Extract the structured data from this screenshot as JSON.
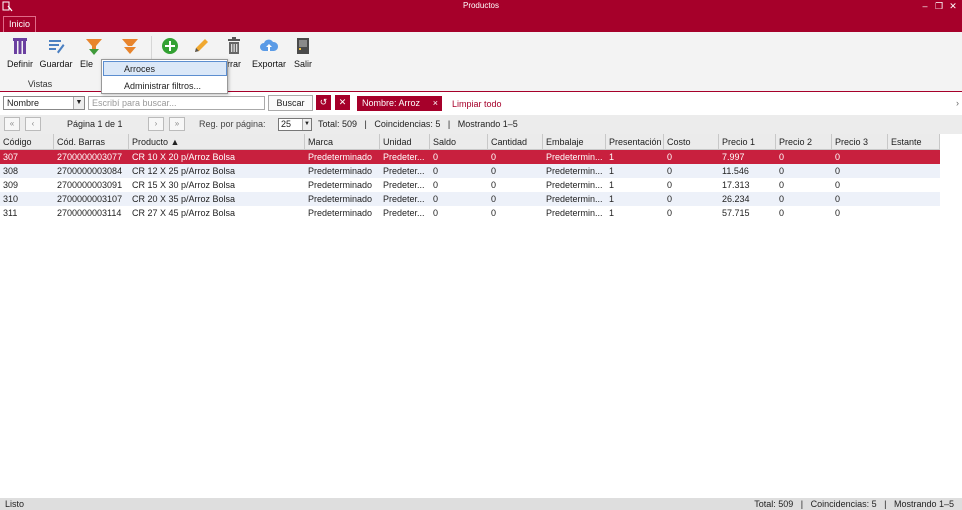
{
  "window": {
    "title": "Productos",
    "controls": [
      "minimize-icon",
      "restore-icon",
      "close-icon"
    ]
  },
  "tabs": [
    {
      "label": "Inicio"
    }
  ],
  "ribbon": {
    "buttons": [
      {
        "label": "Definir",
        "icon": "columns-icon"
      },
      {
        "label": "Guardar",
        "icon": "save-view-icon"
      },
      {
        "label": "Ele",
        "icon": "filter-down-icon"
      },
      {
        "label": "",
        "icon": "filter-dropdown-icon"
      },
      {
        "label": "",
        "icon": "add-icon"
      },
      {
        "label": "",
        "icon": "edit-icon"
      },
      {
        "label": "rrar",
        "icon": "trash-icon"
      },
      {
        "label": "Exportar",
        "icon": "cloud-upload-icon"
      },
      {
        "label": "Salir",
        "icon": "exit-icon"
      }
    ],
    "group_label": "Vistas",
    "dropdown": {
      "items": [
        "Arroces",
        "Administrar filtros..."
      ],
      "selected": "Arroces"
    }
  },
  "filterbar": {
    "field": "Nombre",
    "search_placeholder": "Escribí para buscar...",
    "search_button": "Buscar",
    "chip": "Nombre: Arroz",
    "chip_close": "×",
    "clear_all": "Limpiar todo",
    "reset_icon": "refresh-icon",
    "clear_icon": "close-icon"
  },
  "pager": {
    "first": "«",
    "prev": "‹",
    "page_label": "Página 1 de 1",
    "next": "›",
    "last": "»",
    "per_page_label": "Reg. por página:",
    "per_page": "25",
    "summary": "Total: 509   |   Coincidencias: 5   |   Mostrando 1–5"
  },
  "table": {
    "columns": [
      "Código",
      "Cód. Barras",
      "Producto ▲",
      "Marca",
      "Unidad",
      "Saldo",
      "Cantidad",
      "Embalaje",
      "Presentación",
      "Costo",
      "Precio 1",
      "Precio 2",
      "Precio 3",
      "Estante"
    ],
    "rows": [
      [
        "307",
        "2700000003077",
        "CR 10 X 20 p/Arroz Bolsa",
        "Predeterminado",
        "Predeter...",
        "0",
        "0",
        "Predetermin...",
        "1",
        "0",
        "7.997",
        "0",
        "0",
        ""
      ],
      [
        "308",
        "2700000003084",
        "CR 12 X 25 p/Arroz Bolsa",
        "Predeterminado",
        "Predeter...",
        "0",
        "0",
        "Predetermin...",
        "1",
        "0",
        "11.546",
        "0",
        "0",
        ""
      ],
      [
        "309",
        "2700000003091",
        "CR 15 X 30 p/Arroz Bolsa",
        "Predeterminado",
        "Predeter...",
        "0",
        "0",
        "Predetermin...",
        "1",
        "0",
        "17.313",
        "0",
        "0",
        ""
      ],
      [
        "310",
        "2700000003107",
        "CR 20 X 35 p/Arroz Bolsa",
        "Predeterminado",
        "Predeter...",
        "0",
        "0",
        "Predetermin...",
        "1",
        "0",
        "26.234",
        "0",
        "0",
        ""
      ],
      [
        "311",
        "2700000003114",
        "CR 27 X 45 p/Arroz Bolsa",
        "Predeterminado",
        "Predeter...",
        "0",
        "0",
        "Predetermin...",
        "1",
        "0",
        "57.715",
        "0",
        "0",
        ""
      ]
    ],
    "selected_row": 0
  },
  "status": {
    "left": "Listo",
    "right": "Total: 509   |   Coincidencias: 5   |   Mostrando 1–5"
  },
  "colors": {
    "accent": "#a6002a",
    "selected_row": "#c8203e",
    "alt_row": "#edf1f9"
  }
}
